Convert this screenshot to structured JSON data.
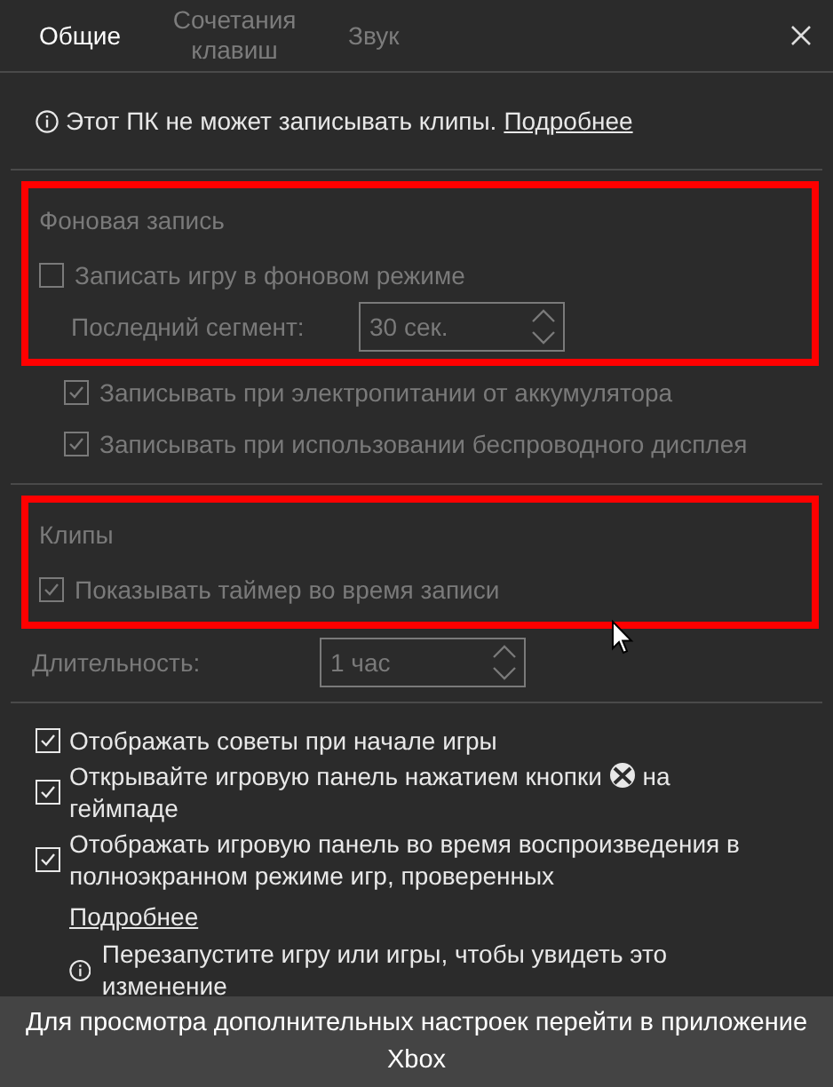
{
  "tabs": [
    {
      "label": "Общие",
      "selected": true
    },
    {
      "label": "Сочетания клавиш",
      "selected": false
    },
    {
      "label": "Звук",
      "selected": false
    }
  ],
  "notice": {
    "text": "Этот ПК не может записывать клипы.",
    "link": "Подробнее"
  },
  "background_recording": {
    "disabled": true,
    "highlighted": true,
    "title": "Фоновая запись",
    "record": {
      "label": "Записать игру в фоновом режиме",
      "checked": false
    },
    "segment": {
      "label": "Последний сегмент:",
      "value": "30 сек."
    },
    "options": [
      {
        "label": "Записывать при электропитании от аккумулятора",
        "checked": true
      },
      {
        "label": "Записывать при использовании беспроводного дисплея",
        "checked": true
      }
    ]
  },
  "clips": {
    "disabled": true,
    "highlighted": true,
    "title": "Клипы",
    "timer": {
      "label": "Показывать таймер во время записи",
      "checked": true
    },
    "duration": {
      "label": "Длительность:",
      "value": "1 час"
    }
  },
  "game_options": [
    {
      "kind": "plain",
      "label": "Отображать советы при начале игры",
      "checked": true
    },
    {
      "kind": "button",
      "label": "Открывайте игровую панель нажатием кнопки",
      "label_after": "на",
      "label_wrapped": "геймпаде",
      "checked": true
    },
    {
      "kind": "plain",
      "label": "Отображать игровую панель во время воспроизведения в полноэкранном режиме игр, проверенных",
      "checked": true
    }
  ],
  "more_link": "Подробнее",
  "restart_note": "Перезапустите игру или игры, чтобы увидеть это изменение",
  "footer": "Для просмотра дополнительных настроек перейти в приложение Xbox"
}
